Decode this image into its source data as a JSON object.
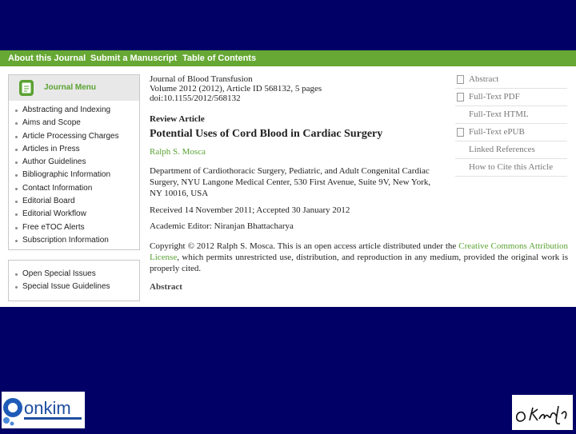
{
  "nav": {
    "about": "About this Journal",
    "submit": "Submit a Manuscript",
    "toc": "Table of Contents"
  },
  "menu": {
    "title": "Journal Menu",
    "items": [
      "Abstracting and Indexing",
      "Aims and Scope",
      "Article Processing Charges",
      "Articles in Press",
      "Author Guidelines",
      "Bibliographic Information",
      "Contact Information",
      "Editorial Board",
      "Editorial Workflow",
      "Free eTOC Alerts",
      "Subscription Information"
    ]
  },
  "special": {
    "items": [
      "Open Special Issues",
      "Special Issue Guidelines"
    ]
  },
  "article": {
    "journal": "Journal of Blood Transfusion",
    "volume": "Volume 2012 (2012), Article ID 568132, 5 pages",
    "doi": "doi:10.1155/2012/568132",
    "type": "Review Article",
    "title": "Potential Uses of Cord Blood in Cardiac Surgery",
    "author": "Ralph S. Mosca",
    "affiliation": "Department of Cardiothoracic Surgery, Pediatric, and Adult Congenital Cardiac Surgery, NYU Langone Medical Center, 530 First Avenue, Suite 9V, New York, NY 10016, USA",
    "dates": "Received 14 November 2011; Accepted 30 January 2012",
    "editor": "Academic Editor: Niranjan Bhattacharya",
    "copyright_pre": "Copyright © 2012 Ralph S. Mosca. This is an open access article distributed under the ",
    "copyright_link": "Creative Commons Attribution License",
    "copyright_post": ", which permits unrestricted use, distribution, and reproduction in any medium, provided the original work is properly cited.",
    "abstract_heading": "Abstract"
  },
  "right_links": [
    {
      "label": "Abstract",
      "icon": "abstract-icon"
    },
    {
      "label": "Full-Text PDF",
      "icon": "pdf-icon"
    },
    {
      "label": "Full-Text HTML",
      "icon": "html-icon"
    },
    {
      "label": "Full-Text ePUB",
      "icon": "epub-icon"
    },
    {
      "label": "Linked References",
      "icon": "none"
    },
    {
      "label": "How to Cite this Article",
      "icon": "none"
    }
  ],
  "colors": {
    "slide_background": "#000066",
    "nav_bar": "#66a833",
    "accent": "#5aa232"
  }
}
